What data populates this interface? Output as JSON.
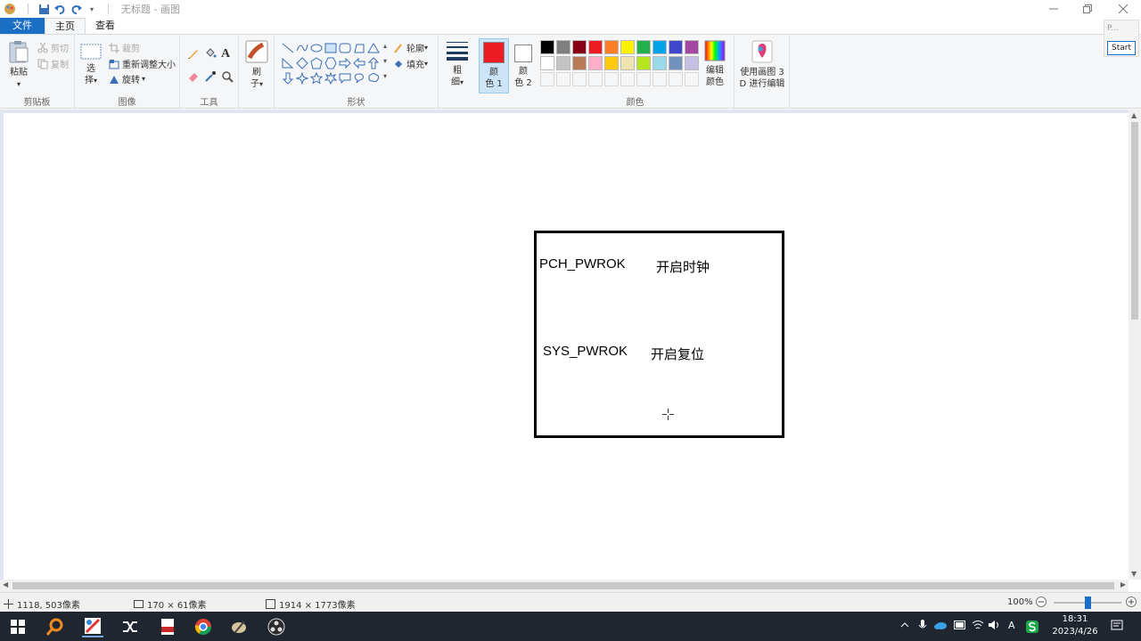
{
  "window": {
    "title": "无标题 - 画图"
  },
  "tabs": [
    {
      "label": "文件"
    },
    {
      "label": "主页"
    },
    {
      "label": "查看"
    }
  ],
  "ribbon": {
    "clipboard": {
      "paste": "粘贴",
      "cut": "剪切",
      "copy": "复制",
      "group": "剪贴板"
    },
    "image": {
      "select_line1": "选",
      "select_line2": "择",
      "crop": "裁剪",
      "resize": "重新调整大小",
      "rotate": "旋转",
      "group": "图像"
    },
    "tools": {
      "group": "工具"
    },
    "brush": {
      "line1": "刷",
      "line2": "子"
    },
    "shapes": {
      "outline": "轮廓",
      "fill": "填充",
      "group": "形状"
    },
    "size": {
      "line1": "粗",
      "line2": "细"
    },
    "color1": {
      "line1": "颜",
      "line2": "色 1"
    },
    "color2": {
      "line1": "颜",
      "line2": "色 2"
    },
    "colors_group": "颜色",
    "edit_colors": {
      "line1": "编辑",
      "line2": "颜色"
    },
    "paint3d": {
      "line1": "使用画图 3",
      "line2": "D 进行编辑"
    }
  },
  "palette": {
    "color1": "#ed1c24",
    "color2": "#ffffff",
    "row1": [
      "#000000",
      "#7f7f7f",
      "#880015",
      "#ed1c24",
      "#ff7f27",
      "#fff200",
      "#22b14c",
      "#00a2e8",
      "#3f48cc",
      "#a349a4"
    ],
    "row2": [
      "#ffffff",
      "#c3c3c3",
      "#b97a57",
      "#ffaec9",
      "#ffc90e",
      "#efe4b0",
      "#b5e61d",
      "#99d9ea",
      "#7092be",
      "#c8bfe7"
    ]
  },
  "canvas": {
    "texts": [
      {
        "text": "PCH_PWROK"
      },
      {
        "text": "开启时钟"
      },
      {
        "text": "SYS_PWROK"
      },
      {
        "text": "开启复位"
      }
    ]
  },
  "floating": {
    "line1": "P...",
    "button": "Start"
  },
  "status": {
    "cursor": "1118, 503像素",
    "selection": "170 × 61像素",
    "image_size": "1914 × 1773像素",
    "zoom": "100%",
    "zoom_level": 0.5
  },
  "taskbar": {
    "time": "18:31",
    "date": "2023/4/26",
    "input_method": "A"
  },
  "colors": {
    "accent": "#1a6fc4",
    "workspace": "#dfe6ef",
    "taskbar": "#1f2630"
  }
}
